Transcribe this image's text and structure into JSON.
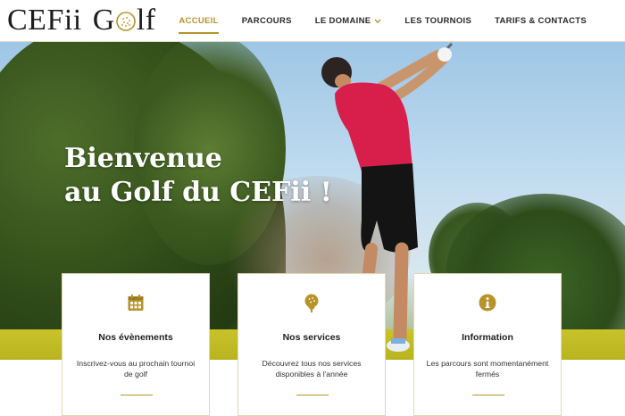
{
  "brand": {
    "logo_part1": "CEFii",
    "logo_part2_pre": "G",
    "logo_part2_post": "lf",
    "accent": "#b8922a"
  },
  "nav": {
    "items": [
      {
        "label": "ACCUEIL",
        "active": true
      },
      {
        "label": "PARCOURS",
        "active": false
      },
      {
        "label": "LE DOMAINE",
        "active": false,
        "has_dropdown": true
      },
      {
        "label": "LES TOURNOIS",
        "active": false
      },
      {
        "label": "TARIFS & CONTACTS",
        "active": false
      }
    ]
  },
  "hero": {
    "headline_line1": "Bienvenue",
    "headline_line2": "au Golf du CEFii !"
  },
  "cards": [
    {
      "icon": "calendar-icon",
      "title": "Nos évènements",
      "desc": "Inscrivez-vous au prochain tournoi de golf"
    },
    {
      "icon": "golf-ball-tee-icon",
      "title": "Nos services",
      "desc": "Découvrez tous nos services disponibles à l'année"
    },
    {
      "icon": "info-icon",
      "title": "Information",
      "desc": "Les parcours sont momentanément fermés"
    }
  ]
}
